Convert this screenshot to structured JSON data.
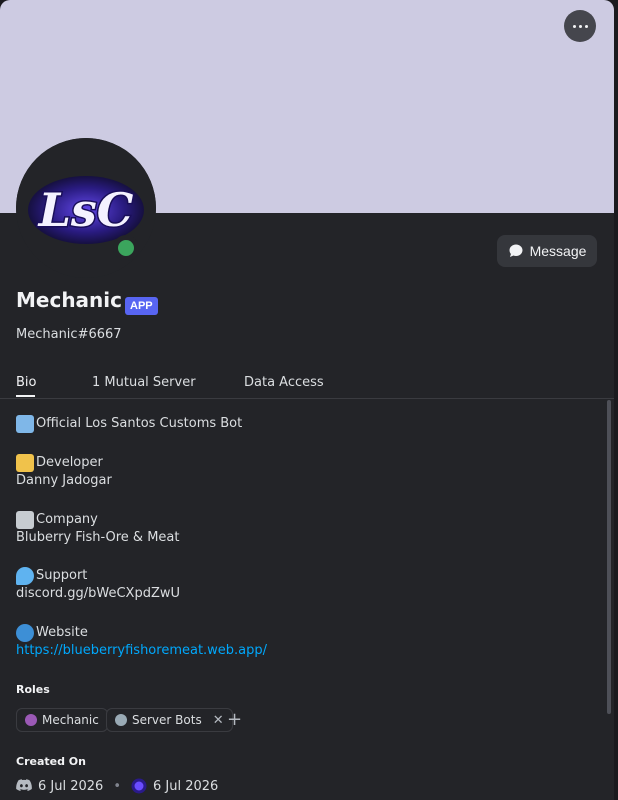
{
  "profile": {
    "display_name": "Mechanic",
    "badge": "APP",
    "tag": "Mechanic#6667",
    "status_color": "#3ba55d",
    "banner_color": "#cdcbe2",
    "avatar_text": "LsC"
  },
  "actions": {
    "message_label": "Message"
  },
  "tabs": [
    {
      "label": "Bio",
      "active": true
    },
    {
      "label": "1 Mutual Server",
      "active": false
    },
    {
      "label": "Data Access",
      "active": false
    }
  ],
  "bio": {
    "intro": "Official Los Santos Customs Bot",
    "developer_heading": "Developer",
    "developer_value": "Danny Jadogar",
    "company_heading": "Company",
    "company_value": "Bluberry Fish-Ore & Meat",
    "support_heading": "Support",
    "support_value": "discord.gg/bWeCXpdZwU",
    "website_heading": "Website",
    "website_value": "https://blueberryfishoremeat.web.app/"
  },
  "roles": {
    "title": "Roles",
    "items": [
      {
        "name": "Mechanic",
        "color": "#9b59b6"
      },
      {
        "name": "Server Bots",
        "color": "#99aab5"
      }
    ]
  },
  "created": {
    "title": "Created On",
    "discord_date": "6 Jul 2026",
    "server_date": "6 Jul 2026"
  },
  "icons": {
    "more": "more-icon",
    "message": "chat-bubble-icon",
    "discord": "discord-icon",
    "server": "server-icon"
  }
}
